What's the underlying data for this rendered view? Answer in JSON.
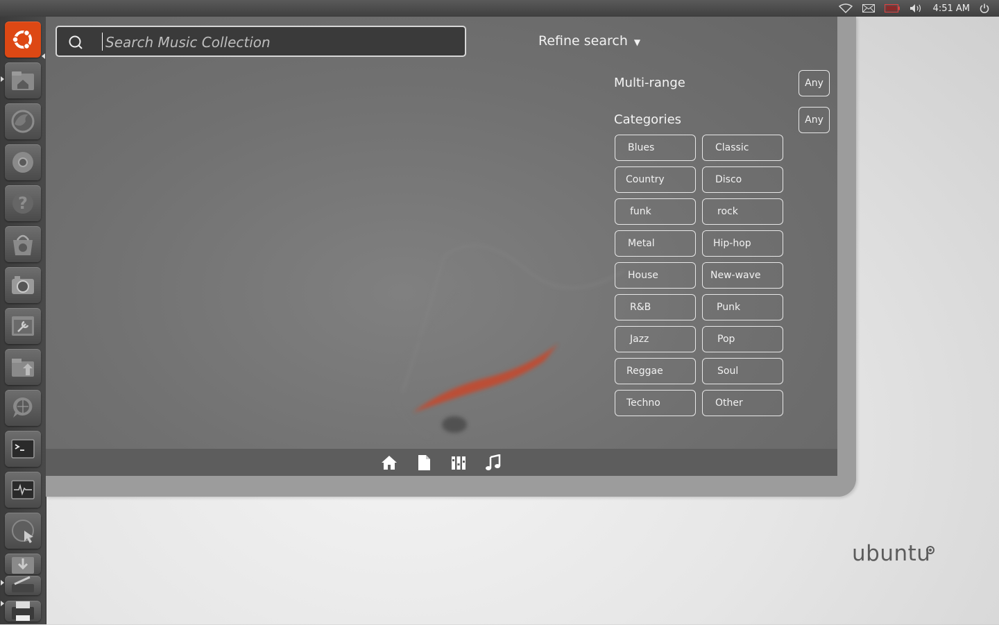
{
  "top_panel": {
    "clock": "4:51 AM",
    "tray_icons": [
      "wifi-icon",
      "mail-icon",
      "battery-icon",
      "volume-icon",
      "power-icon"
    ]
  },
  "launcher": {
    "items": [
      "ubuntu-logo-icon",
      "home-folder-icon",
      "firefox-icon",
      "chrome-icon",
      "help-icon",
      "software-center-icon",
      "camera-icon",
      "system-settings-icon",
      "file-upload-icon",
      "globe-chat-icon",
      "terminal-icon",
      "system-monitor-icon",
      "network-icon",
      "downloads-icon",
      "scanner-icon",
      "printer-icon"
    ]
  },
  "dash": {
    "search": {
      "placeholder": "Search Music Collection",
      "value": ""
    },
    "refine_label": "Refine search",
    "filters": {
      "multi_range": {
        "label": "Multi-range",
        "any_label": "Any"
      },
      "categories": {
        "label": "Categories",
        "any_label": "Any",
        "items": [
          "Blues",
          "Classic",
          "Country",
          "Disco",
          "funk",
          "rock",
          "Metal",
          "Hip-hop",
          "House",
          "New-wave",
          "R&B",
          "Punk",
          "Jazz",
          "Pop",
          "Reggae",
          "Soul",
          "Techno",
          "Other"
        ]
      }
    },
    "lenses": [
      "home-lens-icon",
      "files-lens-icon",
      "applications-lens-icon",
      "music-lens-icon"
    ]
  },
  "wallpaper": {
    "logo_text": "ubuntu"
  },
  "colors": {
    "ubuntu_orange": "#dd4814",
    "dash_bg": "#757575"
  }
}
